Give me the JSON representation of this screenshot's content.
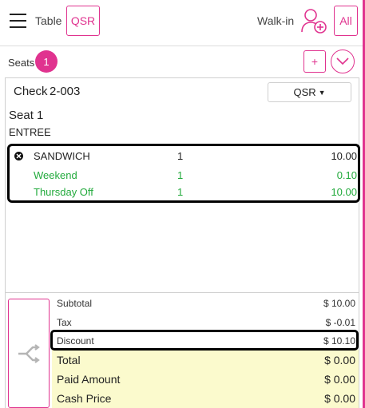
{
  "header": {
    "table_label": "Table",
    "qsr_button": "QSR",
    "walkin_label": "Walk-in",
    "all_button": "All"
  },
  "seats": {
    "label": "Seats",
    "count": "1",
    "add_button": "+"
  },
  "check": {
    "label": "Check",
    "number": "2-003",
    "type_selected": "QSR",
    "seat_title": "Seat 1",
    "course": "ENTREE",
    "items": [
      {
        "name": "SANDWICH",
        "qty": "1",
        "price": "10.00"
      },
      {
        "name": "Weekend",
        "qty": "1",
        "price": "0.10"
      },
      {
        "name": "Thursday Off",
        "qty": "1",
        "price": "10.00"
      }
    ]
  },
  "totals": {
    "subtotal_label": "Subtotal",
    "subtotal_value": "$ 10.00",
    "tax_label": "Tax",
    "tax_value": "$ -0.01",
    "discount_label": "Discount",
    "discount_value": "$ 10.10",
    "total_label": "Total",
    "total_value": "$ 0.00",
    "paid_label": "Paid Amount",
    "paid_value": "$ 0.00",
    "cash_label": "Cash Price",
    "cash_value": "$ 0.00"
  },
  "colors": {
    "accent": "#e0338f",
    "discount_green": "#22aa3c",
    "totals_highlight": "#fbfacd"
  }
}
